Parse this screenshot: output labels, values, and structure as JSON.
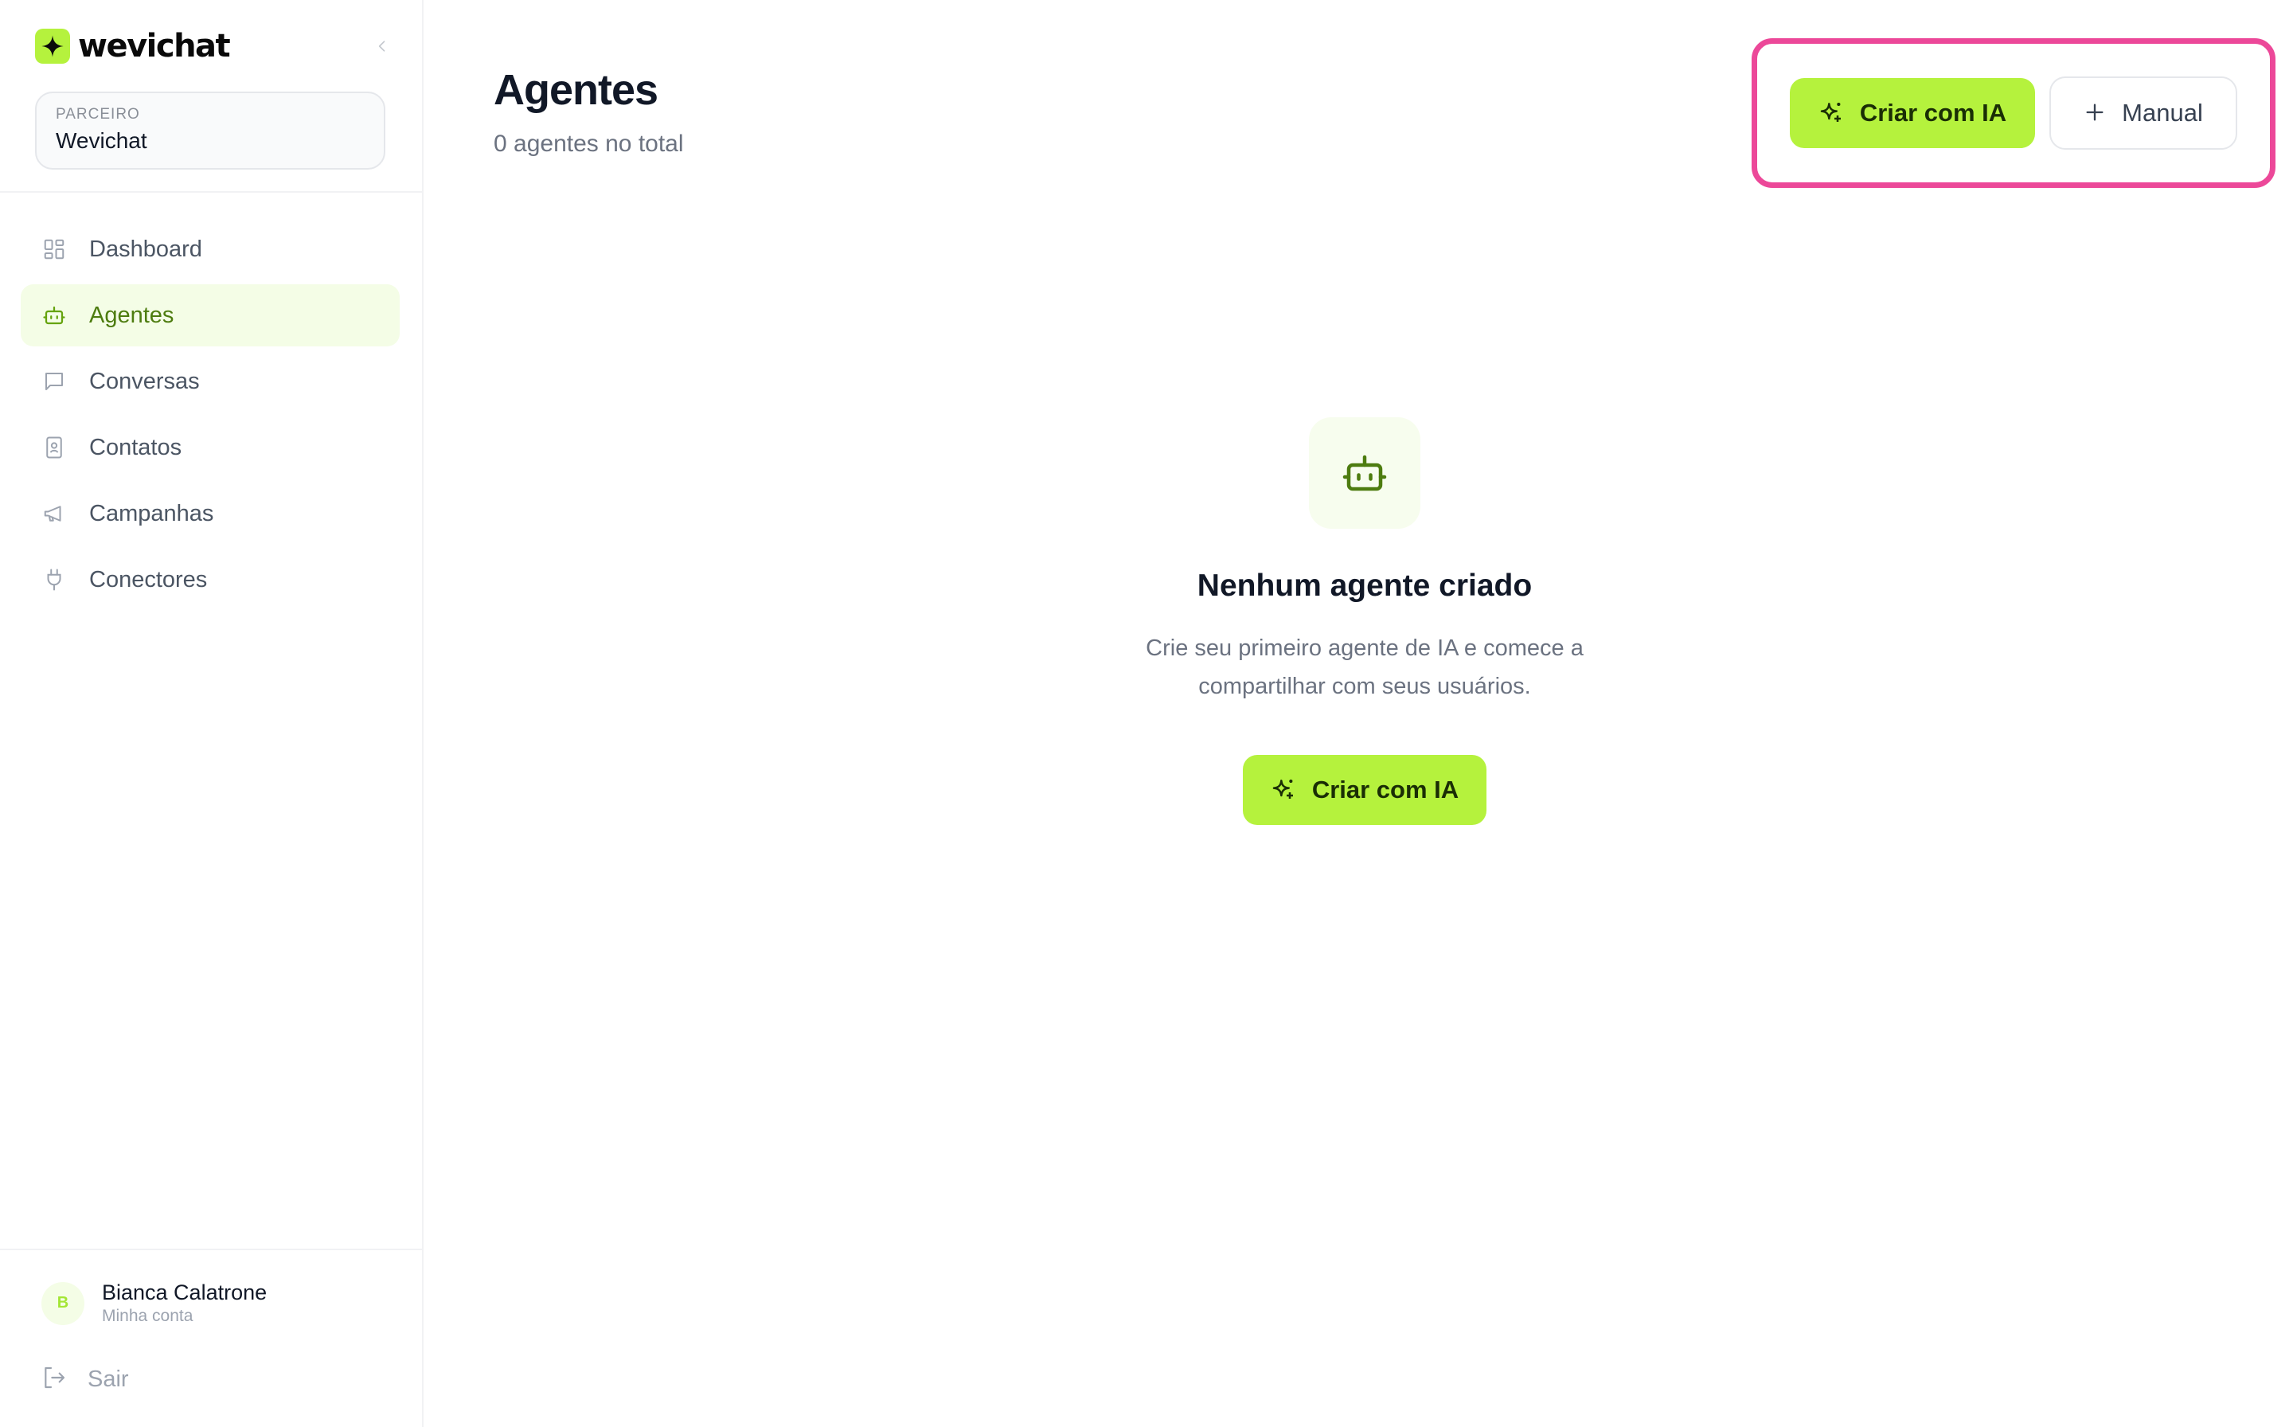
{
  "brand": {
    "name": "wevichat",
    "accent": "#b5f23d"
  },
  "partner": {
    "label": "PARCEIRO",
    "name": "Wevichat"
  },
  "nav": {
    "items": [
      {
        "label": "Dashboard",
        "icon": "dashboard-icon",
        "active": false
      },
      {
        "label": "Agentes",
        "icon": "bot-icon",
        "active": true
      },
      {
        "label": "Conversas",
        "icon": "message-icon",
        "active": false
      },
      {
        "label": "Contatos",
        "icon": "contact-book-icon",
        "active": false
      },
      {
        "label": "Campanhas",
        "icon": "megaphone-icon",
        "active": false
      },
      {
        "label": "Conectores",
        "icon": "plug-icon",
        "active": false
      }
    ]
  },
  "user": {
    "initial": "B",
    "name": "Bianca Calatrone",
    "subtitle": "Minha conta"
  },
  "logout": {
    "label": "Sair"
  },
  "page": {
    "title": "Agentes",
    "subtitle": "0 agentes no total"
  },
  "actions": {
    "create_ai_label": "Criar com IA",
    "manual_label": "Manual"
  },
  "empty_state": {
    "title": "Nenhum agente criado",
    "description": "Crie seu primeiro agente de IA e comece a compartilhar com seus usuários.",
    "button_label": "Criar com IA"
  },
  "colors": {
    "highlight": "#ec4899",
    "active_nav_bg": "#f4fde6",
    "active_nav_text": "#4d7c0f"
  }
}
